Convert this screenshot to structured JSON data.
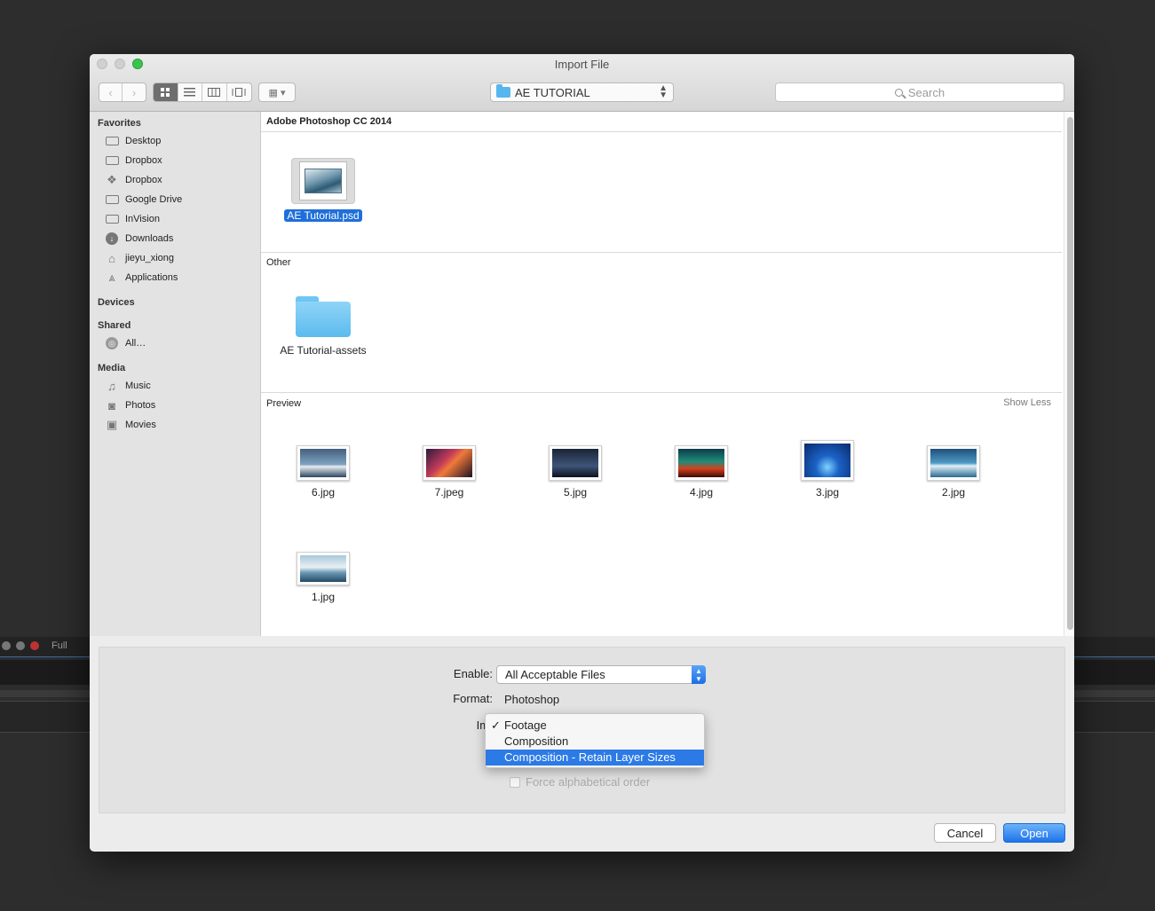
{
  "background": {
    "viewer_zoom": "Full"
  },
  "dialog": {
    "title": "Import File",
    "toolbar": {
      "back_icon": "chevron-left-icon",
      "forward_icon": "chevron-right-icon",
      "view_modes": [
        "icon-view",
        "list-view",
        "column-view",
        "coverflow-view"
      ],
      "selected_view": "icon-view",
      "arrange_icon": "grid-arrange-icon",
      "path": "AE TUTORIAL",
      "search_placeholder": "Search"
    },
    "sidebar": {
      "favorites_label": "Favorites",
      "favorites": [
        {
          "label": "Desktop",
          "icon": "folder-icon"
        },
        {
          "label": "Dropbox",
          "icon": "folder-icon"
        },
        {
          "label": "Dropbox",
          "icon": "dropbox-icon"
        },
        {
          "label": "Google Drive",
          "icon": "folder-icon"
        },
        {
          "label": "InVision",
          "icon": "folder-icon"
        },
        {
          "label": "Downloads",
          "icon": "download-icon"
        },
        {
          "label": "jieyu_xiong",
          "icon": "home-icon"
        },
        {
          "label": "Applications",
          "icon": "applications-icon"
        }
      ],
      "devices_label": "Devices",
      "shared_label": "Shared",
      "shared": [
        {
          "label": "All…",
          "icon": "network-icon"
        }
      ],
      "media_label": "Media",
      "media": [
        {
          "label": "Music",
          "icon": "music-icon"
        },
        {
          "label": "Photos",
          "icon": "camera-icon"
        },
        {
          "label": "Movies",
          "icon": "film-icon"
        }
      ]
    },
    "content": {
      "section1": {
        "title": "Adobe Photoshop CC 2014",
        "file": "AE Tutorial.psd"
      },
      "section2": {
        "title": "Other",
        "folder": "AE Tutorial-assets"
      },
      "section3": {
        "title": "Preview",
        "show_less": "Show Less",
        "files": [
          "6.jpg",
          "7.jpeg",
          "5.jpg",
          "4.jpg",
          "3.jpg",
          "2.jpg",
          "1.jpg"
        ]
      }
    },
    "options": {
      "enable_label": "Enable:",
      "enable_value": "All Acceptable Files",
      "format_label": "Format:",
      "format_value": "Photoshop",
      "import_as_label": "Import A",
      "import_as_options": [
        "Footage",
        "Composition",
        "Composition - Retain Layer Sizes"
      ],
      "import_as_checked": "Footage",
      "import_as_highlighted": "Composition - Retain Layer Sizes",
      "force_alpha": "Force alphabetical order"
    },
    "buttons": {
      "cancel": "Cancel",
      "open": "Open"
    }
  }
}
